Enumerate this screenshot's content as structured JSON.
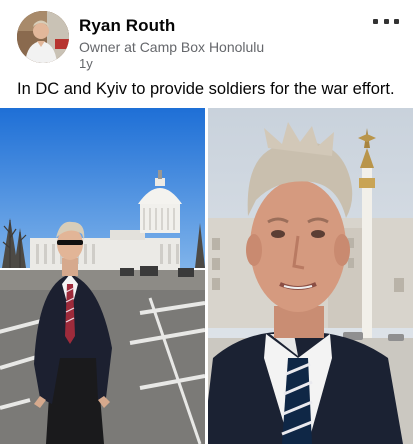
{
  "post": {
    "author_name": "Ryan Routh",
    "author_subtitle": "Owner at Camp Box Honolulu",
    "timestamp": "1y",
    "more_icon": "more-horizontal-icon",
    "text": "In DC and Kyiv to provide soldiers for the war effort."
  },
  "photos": [
    {
      "subject": "Man in dark coat standing in front of the US Capitol"
    },
    {
      "subject": "Close-up of man in suit and striped tie in Kyiv"
    }
  ]
}
